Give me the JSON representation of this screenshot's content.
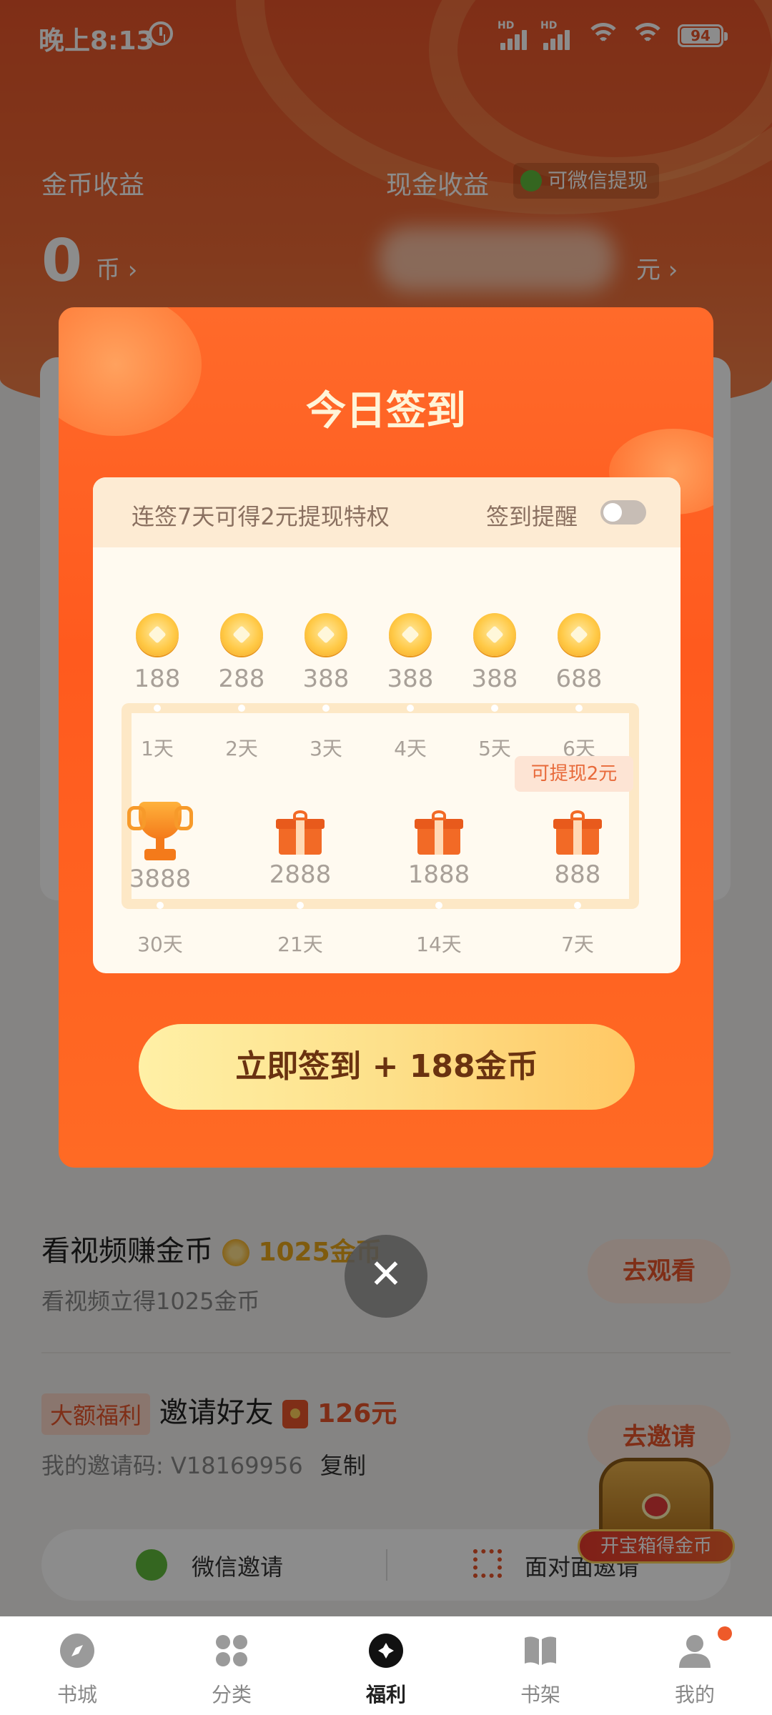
{
  "status_bar": {
    "time": "晚上8:13",
    "hd_label": "HD",
    "battery": "94"
  },
  "earnings": {
    "coin_label": "金币收益",
    "cash_label": "现金收益",
    "withdraw_tag": "可微信提现",
    "coin_value": "0",
    "coin_unit": "币 ›",
    "cash_unit": "元 ›"
  },
  "tasks": {
    "watch": {
      "title": "看视频赚金币",
      "reward": "1025金币",
      "subtitle": "看视频立得1025金币",
      "button": "去观看"
    },
    "invite": {
      "tag": "大额福利",
      "title": "邀请好友",
      "reward": "126元",
      "code_text": "我的邀请码: V18169956",
      "copy": "复制",
      "button": "去邀请"
    },
    "share_wechat": "微信邀请",
    "share_face": "面对面邀请"
  },
  "chest_label": "开宝箱得金币",
  "modal": {
    "title": "今日签到",
    "streak_text": "连签7天可得2元提现特权",
    "reminder_label": "签到提醒",
    "reminder_on": false,
    "row1": [
      {
        "amount": "188",
        "day": "1天"
      },
      {
        "amount": "288",
        "day": "2天"
      },
      {
        "amount": "388",
        "day": "3天"
      },
      {
        "amount": "388",
        "day": "4天"
      },
      {
        "amount": "388",
        "day": "5天"
      },
      {
        "amount": "688",
        "day": "6天"
      }
    ],
    "cashout_badge": "可提现2元",
    "row2": [
      {
        "amount": "3888",
        "day": "30天",
        "icon": "trophy-icon"
      },
      {
        "amount": "2888",
        "day": "21天",
        "icon": "gift-icon"
      },
      {
        "amount": "1888",
        "day": "14天",
        "icon": "gift-icon"
      },
      {
        "amount": "888",
        "day": "7天",
        "icon": "gift-icon"
      }
    ],
    "signin_button": "立即签到 + 188金币",
    "close_symbol": "✕"
  },
  "bottom_nav": [
    {
      "label": "书城",
      "icon": "compass-icon"
    },
    {
      "label": "分类",
      "icon": "grid-icon"
    },
    {
      "label": "福利",
      "icon": "gift-circle-icon",
      "active": true
    },
    {
      "label": "书架",
      "icon": "book-icon"
    },
    {
      "label": "我的",
      "icon": "user-icon",
      "badge": true
    }
  ],
  "colors": {
    "accent": "#ff5a1e",
    "coin": "#ffc946",
    "button": "#fde08a",
    "active_nav": "#222222"
  }
}
